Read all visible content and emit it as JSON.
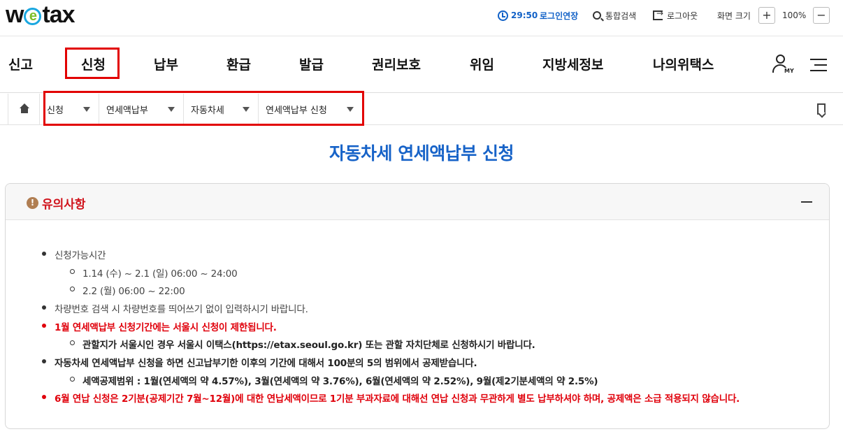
{
  "logo": {
    "pre": "w",
    "e": "e",
    "post": "tax"
  },
  "topbar": {
    "timer": "29:50",
    "extend_label": "로그인연장",
    "search_label": "통합검색",
    "logout_label": "로그아웃",
    "zoom_label": "화면 크기",
    "zoom_plus": "+",
    "zoom_value": "100%",
    "zoom_minus": "−"
  },
  "mainnav": {
    "items": [
      "신고",
      "신청",
      "납부",
      "환급",
      "발급",
      "권리보호",
      "위임",
      "지방세정보",
      "나의위택스"
    ],
    "my_label": "MY"
  },
  "breadcrumb": {
    "items": [
      "신청",
      "연세액납부",
      "자동차세",
      "연세액납부 신청"
    ]
  },
  "page": {
    "title": "자동차세 연세액납부 신청"
  },
  "notice": {
    "title": "유의사항",
    "warn_glyph": "!",
    "items": [
      "신청가능시간",
      "1.14 (수) ~ 2.1 (일) 06:00 ~ 24:00",
      "2.2 (월) 06:00 ~ 22:00",
      "차량번호 검색 시 차량번호를 띄어쓰기 없이 입력하시기 바랍니다.",
      "1월 연세액납부 신청기간에는 서울시 신청이 제한됩니다.",
      "관할지가 서울시인 경우 서울시 이택스(https://etax.seoul.go.kr) 또는 관할 자치단체로 신청하시기 바랍니다.",
      "자동차세 연세액납부 신청을 하면 신고납부기한 이후의 기간에 대해서 100분의 5의 범위에서 공제받습니다.",
      "세액공제범위 : 1월(연세액의 약 4.57%), 3월(연세액의 약 3.76%), 6월(연세액의 약 2.52%), 9월(제2기분세액의 약 2.5%)",
      "6월 연납 신청은 2기분(공제기간 7월~12월)에 대한 연납세액이므로 1기분 부과자료에 대해선 연납 신청과 무관하게 별도 납부하셔야 하며, 공제액은 소급 적용되지 않습니다."
    ]
  },
  "colors": {
    "accent_blue": "#1763c8",
    "highlight_red": "#e20000",
    "notice_red": "#e0000b"
  }
}
